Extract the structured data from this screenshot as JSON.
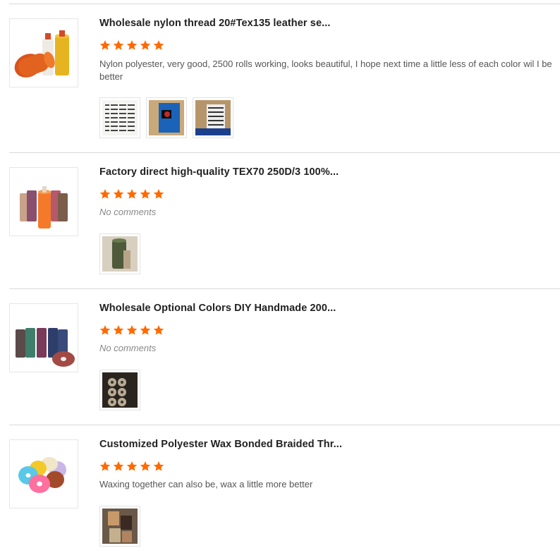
{
  "accent_color": "#ff6a00",
  "reviews": [
    {
      "title": "Wholesale nylon thread 20#Tex135 leather se...",
      "rating": 5,
      "comment": "Nylon polyester, very good, 2500 rolls working, looks beautiful, I hope next time a little less of each color wil I be better",
      "product_image": "orange-yellow-white-thread-spools",
      "photos": [
        "labeled-boxes-photo",
        "blue-package-photo",
        "carton-boxes-photo"
      ]
    },
    {
      "title": "Factory direct high-quality TEX70 250D/3 100%...",
      "rating": 5,
      "comment": "No comments",
      "product_image": "pastel-thread-spools",
      "photos": [
        "green-spool-photo"
      ]
    },
    {
      "title": "Wholesale Optional Colors DIY Handmade 200...",
      "rating": 5,
      "comment": "No comments",
      "product_image": "dark-thread-spools",
      "photos": [
        "spools-in-box-photo"
      ]
    },
    {
      "title": "Customized Polyester Wax Bonded Braided Thr...",
      "rating": 5,
      "comment": "Waxing together can also be, wax a little more better",
      "product_image": "colorful-waxed-thread-spools",
      "photos": [
        "hands-with-spools-photo"
      ]
    }
  ]
}
